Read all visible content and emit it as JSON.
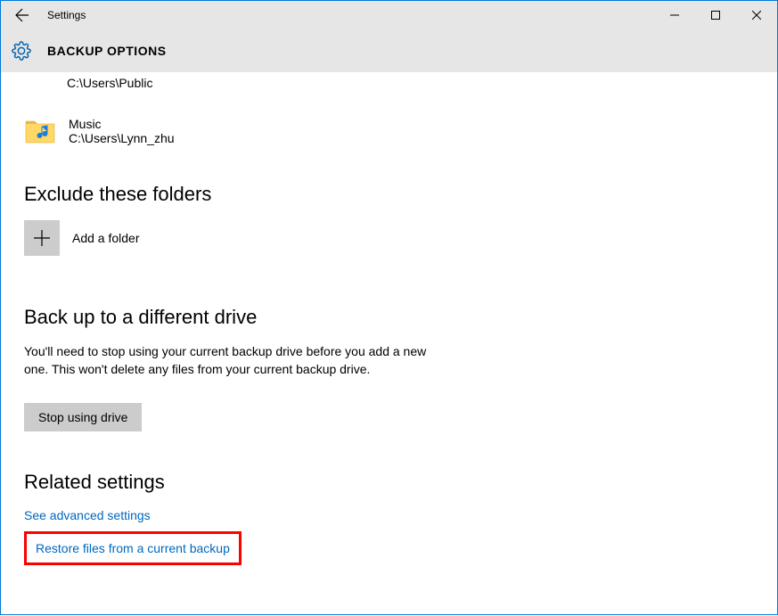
{
  "window": {
    "title": "Settings"
  },
  "header": {
    "title": "BACKUP OPTIONS"
  },
  "partialFolder": {
    "path": "C:\\Users\\Public"
  },
  "musicFolder": {
    "name": "Music",
    "path": "C:\\Users\\Lynn_zhu"
  },
  "excludeSection": {
    "heading": "Exclude these folders",
    "addLabel": "Add a folder"
  },
  "differentDriveSection": {
    "heading": "Back up to a different drive",
    "body": "You'll need to stop using your current backup drive before you add a new one. This won't delete any files from your current backup drive.",
    "buttonLabel": "Stop using drive"
  },
  "relatedSection": {
    "heading": "Related settings",
    "link1": "See advanced settings",
    "link2": "Restore files from a current backup"
  }
}
